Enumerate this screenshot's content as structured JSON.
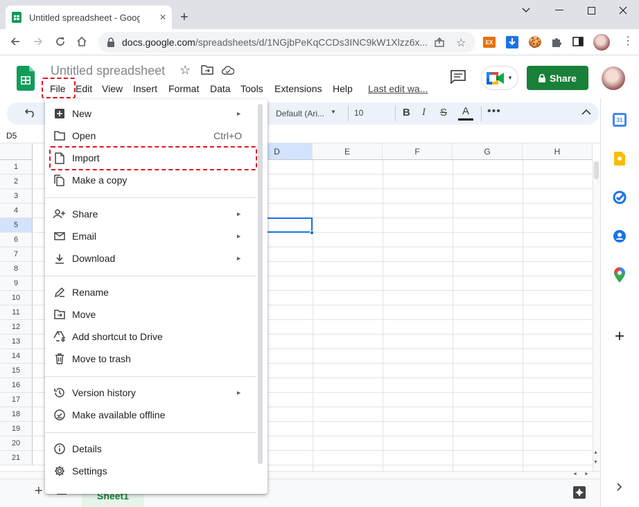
{
  "browser": {
    "tab_title": "Untitled spreadsheet - Google S",
    "url_host": "docs.google.com",
    "url_path": "/spreadsheets/d/1NGjbPeKqCCDs3INC9kW1Xlzz6x...",
    "extension_badge": "EX"
  },
  "sheet": {
    "doc_title": "Untitled spreadsheet",
    "menus": [
      "File",
      "Edit",
      "View",
      "Insert",
      "Format",
      "Data",
      "Tools",
      "Extensions",
      "Help"
    ],
    "last_edit": "Last edit wa...",
    "share_label": "Share",
    "cell_ref": "D5",
    "font_name": "Default (Ari...",
    "font_size": "10",
    "columns": [
      "D",
      "E",
      "F",
      "G",
      "H"
    ],
    "rows": [
      "1",
      "2",
      "3",
      "4",
      "5",
      "6",
      "7",
      "8",
      "9",
      "10",
      "11",
      "12",
      "13",
      "14",
      "15",
      "16",
      "17",
      "18",
      "19",
      "20",
      "21"
    ],
    "sheet_tab": "Sheet1",
    "calendar_day": "31"
  },
  "file_menu": {
    "items": [
      {
        "label": "New",
        "submenu": "►"
      },
      {
        "label": "Open",
        "shortcut": "Ctrl+O"
      },
      {
        "label": "Import"
      },
      {
        "label": "Make a copy"
      },
      {
        "label": "Share",
        "submenu": "►"
      },
      {
        "label": "Email",
        "submenu": "►"
      },
      {
        "label": "Download",
        "submenu": "►"
      },
      {
        "label": "Rename"
      },
      {
        "label": "Move"
      },
      {
        "label": "Add shortcut to Drive"
      },
      {
        "label": "Move to trash"
      },
      {
        "label": "Version history",
        "submenu": "►"
      },
      {
        "label": "Make available offline"
      },
      {
        "label": "Details"
      },
      {
        "label": "Settings"
      }
    ]
  },
  "colors": {
    "accent_green": "#188038",
    "highlight_red": "#e3141c",
    "selection_blue": "#1a73e8"
  }
}
